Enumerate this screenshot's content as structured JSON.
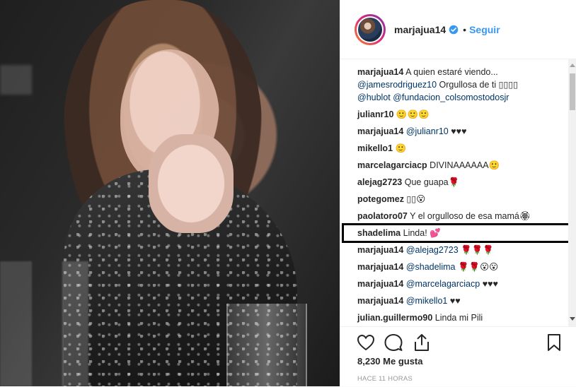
{
  "header": {
    "username": "marjajua14",
    "separator": "•",
    "follow_label": "Seguir",
    "verified_icon": "verified-badge-icon"
  },
  "caption": {
    "username": "marjajua14",
    "text": "A quien estaré viendo...",
    "line2_mention": "@jamesrodriguez10",
    "line2_text": "Orgullosa de ti ▯▯▯▯",
    "line3_mention1": "@hublot",
    "line3_mention2": "@fundacion_colsomostodosjr"
  },
  "comments": [
    {
      "user": "julianr10",
      "text": "🙂🙂🙂"
    },
    {
      "user": "marjajua14",
      "mention": "@julianr10",
      "text": "♥♥♥"
    },
    {
      "user": "mikello1",
      "text": "🙂"
    },
    {
      "user": "marcelagarciacp",
      "text": "DIVINAAAAAA🙂"
    },
    {
      "user": "alejag2723",
      "text": "Que guapa🌹"
    },
    {
      "user": "potegomez",
      "text": "▯▯😮"
    },
    {
      "user": "paolatoro07",
      "text": "Y el orgulloso de esa mamá🏵"
    },
    {
      "user": "shadelima",
      "text": "Linda! 💕"
    },
    {
      "user": "marjajua14",
      "mention": "@alejag2723",
      "text": "🌹🌹🌹"
    },
    {
      "user": "marjajua14",
      "mention": "@shadelima",
      "text": "🌹🌹😮😮"
    },
    {
      "user": "marjajua14",
      "mention": "@marcelagarciacp",
      "text": "♥♥♥"
    },
    {
      "user": "marjajua14",
      "mention": "@mikello1",
      "text": "♥♥"
    },
    {
      "user": "julian.guillermo90",
      "text": "Linda mi Pili"
    }
  ],
  "actions": {
    "like_icon": "heart-icon",
    "comment_icon": "comment-icon",
    "share_icon": "share-icon",
    "save_icon": "bookmark-icon"
  },
  "likes_text": "8,230 Me gusta",
  "time_text": "HACE 11 HORAS",
  "colors": {
    "link": "#003569",
    "follow": "#3897f0",
    "text": "#262626",
    "muted": "#999999",
    "highlight_border": "#000000"
  }
}
